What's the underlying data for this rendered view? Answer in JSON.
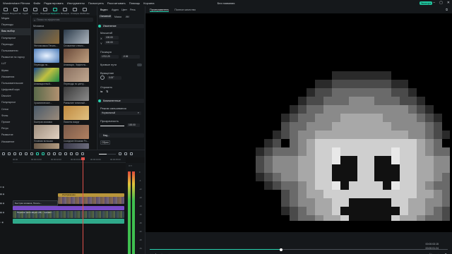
{
  "app": {
    "title": "Без названия",
    "menu": [
      "Wondershare Filmora",
      "Файл",
      "Редактировать",
      "Инструменты",
      "Посмотреть",
      "Рассчитывать",
      "Помощь",
      "Корзина"
    ],
    "export_label": "Экспорт"
  },
  "media_tabs": [
    "Медиа",
    "Вирусостки",
    "Аудио",
    "Титры",
    "Переходы",
    "Эффекты",
    "Фильтры",
    "Стикеры",
    "Шаблоны"
  ],
  "sidebar": {
    "items": [
      "Медиа",
      "Переходы",
      "Ваш выбор",
      "Популярное",
      "Переходы",
      "Пользователи",
      "Размытие по гауссу",
      "LUT",
      "Шумы",
      "Искажения",
      "Пользовательские",
      "Цифровой шум",
      "Dissolve",
      "Популярное",
      "Сетки",
      "Фоны",
      "Прочие",
      "Ретро",
      "Размытие",
      "Искажение",
      "Смешивание",
      "Художественное",
      "Моменты"
    ]
  },
  "media": {
    "search_placeholder": "Поиск по эффектам",
    "section_title": "Мозаика",
    "items": [
      {
        "name": "Фотомозаика Печать..."
      },
      {
        "name": "Сломанное стекло..."
      },
      {
        "name": "Переходы по..."
      },
      {
        "name": "Анимация, Эффекты..."
      },
      {
        "name": "Анимационный..."
      },
      {
        "name": "Переходы по цвету..."
      },
      {
        "name": "Хроматическое..."
      },
      {
        "name": "Размытие типичный..."
      },
      {
        "name": "Быстрая мозаика"
      },
      {
        "name": "Пиксель вокруг"
      },
      {
        "name": "Плавная вспышка"
      },
      {
        "name": "Соседние Мозаики Ро..."
      },
      {
        "name": "Эффекты Рисования..."
      },
      {
        "name": "Черный Размыто..."
      }
    ]
  },
  "props": {
    "tabs": [
      "Видео",
      "Аудио",
      "Цвет",
      "Речь"
    ],
    "subtabs": [
      "Основной",
      "Маска",
      "ИИ"
    ],
    "section_transform": "Изменение",
    "scale_label": "Масштаб",
    "x_label": "X",
    "y_label": "Y",
    "x_value": "100.00",
    "y_value": "100.00",
    "position_label": "Позиция",
    "pos_x": "1702.29",
    "pos_y": "-0.06",
    "rotate_label": "Кривые пути",
    "rotation_label": "Вращение",
    "rotation_value": "0.00°",
    "flip_label": "Отразить",
    "section_composite": "Компонентные",
    "blend_label": "Режим смешивания",
    "blend_value": "Нормальный",
    "opacity_label": "Прозрачность",
    "opacity_value": "100.00",
    "section_stab": "Кад...",
    "reset_label": "Сброс"
  },
  "preview": {
    "tabs": [
      "Проигрыватель",
      "Полное качество"
    ],
    "timecode_total": "00:00:03:15",
    "timecode_current": "00:00:01:24",
    "progress": 0.44
  },
  "timeline": {
    "ruler_ticks": [
      "00:00",
      "00:00:01:00",
      "00:00:02:00",
      "00:00:03:00",
      "00:00:04:00",
      "00:00:05:00"
    ],
    "clip_title": "Изображение",
    "clip_video_a": "Быстрая мозаика, Печать...",
    "clip_video_b": "Перенос фото-видео (01) - профил...",
    "meter_labels": [
      "0",
      "-6",
      "-12",
      "-18",
      "-24",
      "-30",
      "-36",
      "-42",
      "-48",
      "-54"
    ],
    "meter_footer": "Л П"
  },
  "colors": {
    "accent": "#29d3b0",
    "playhead": "#e0504a",
    "clip_title": "#b8953a",
    "clip_purple": "#7a4cc8",
    "clip_teal": "#2fa98a"
  }
}
